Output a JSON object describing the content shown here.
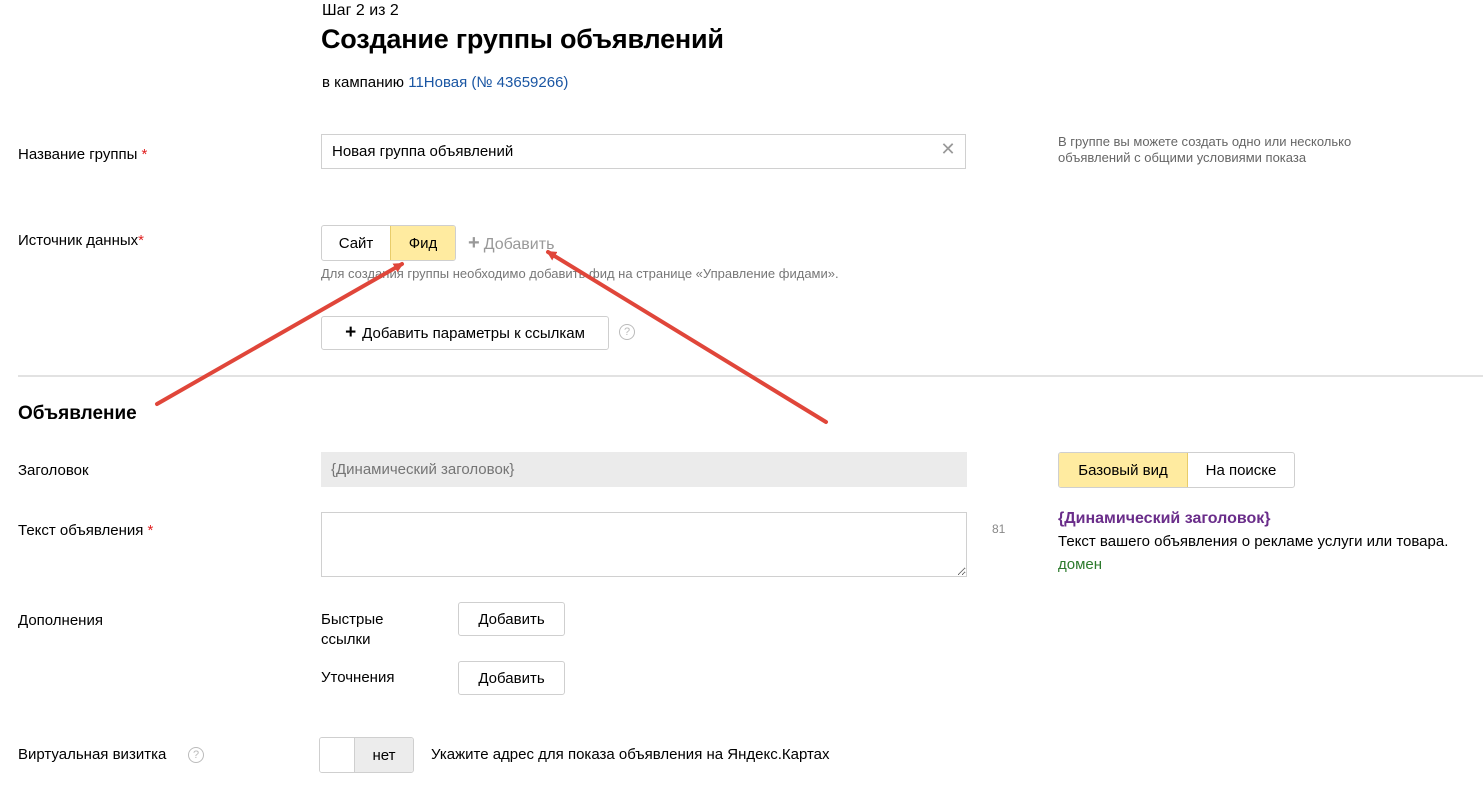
{
  "header": {
    "step": "Шаг 2 из 2",
    "title": "Создание группы объявлений",
    "campaign_prefix": "в кампанию",
    "campaign_link": "11Новая (№ 43659266)"
  },
  "group_name": {
    "label": "Название группы",
    "required_mark": "*",
    "value": "Новая группа объявлений",
    "hint": "В группе вы можете создать одно или несколько объявлений с общими условиями показа"
  },
  "data_source": {
    "label": "Источник данных",
    "required_mark": "*",
    "options": [
      "Сайт",
      "Фид"
    ],
    "selected": "Фид",
    "add_label": "Добавить",
    "note": "Для создания группы необходимо добавить фид на странице «Управление фидами».",
    "params_button": "Добавить параметры к ссылкам"
  },
  "ad": {
    "section_title": "Объявление",
    "headline_label": "Заголовок",
    "headline_placeholder": "{Динамический заголовок}",
    "text_label": "Текст объявления",
    "text_required_mark": "*",
    "text_counter": "81",
    "preview_tabs": [
      "Базовый вид",
      "На поиске"
    ],
    "preview_selected": "Базовый вид",
    "preview_title": "{Динамический заголовок}",
    "preview_text": "Текст вашего объявления о рекламе услуги или товара.",
    "preview_domain": "домен"
  },
  "extensions": {
    "label": "Дополнения",
    "quick_links_label": "Быстрые ссылки",
    "quick_links_button": "Добавить",
    "callouts_label": "Уточнения",
    "callouts_button": "Добавить"
  },
  "vcard": {
    "label": "Виртуальная визитка",
    "toggle_state": "нет",
    "description": "Укажите адрес для показа объявления на Яндекс.Картах"
  },
  "colors": {
    "accent_yellow": "#ffeba0",
    "link_blue": "#1a56a3",
    "required_red": "#e02020",
    "arrow_red": "#e0463a",
    "preview_purple": "#6a2d8a",
    "domain_green": "#2c7a2c"
  }
}
